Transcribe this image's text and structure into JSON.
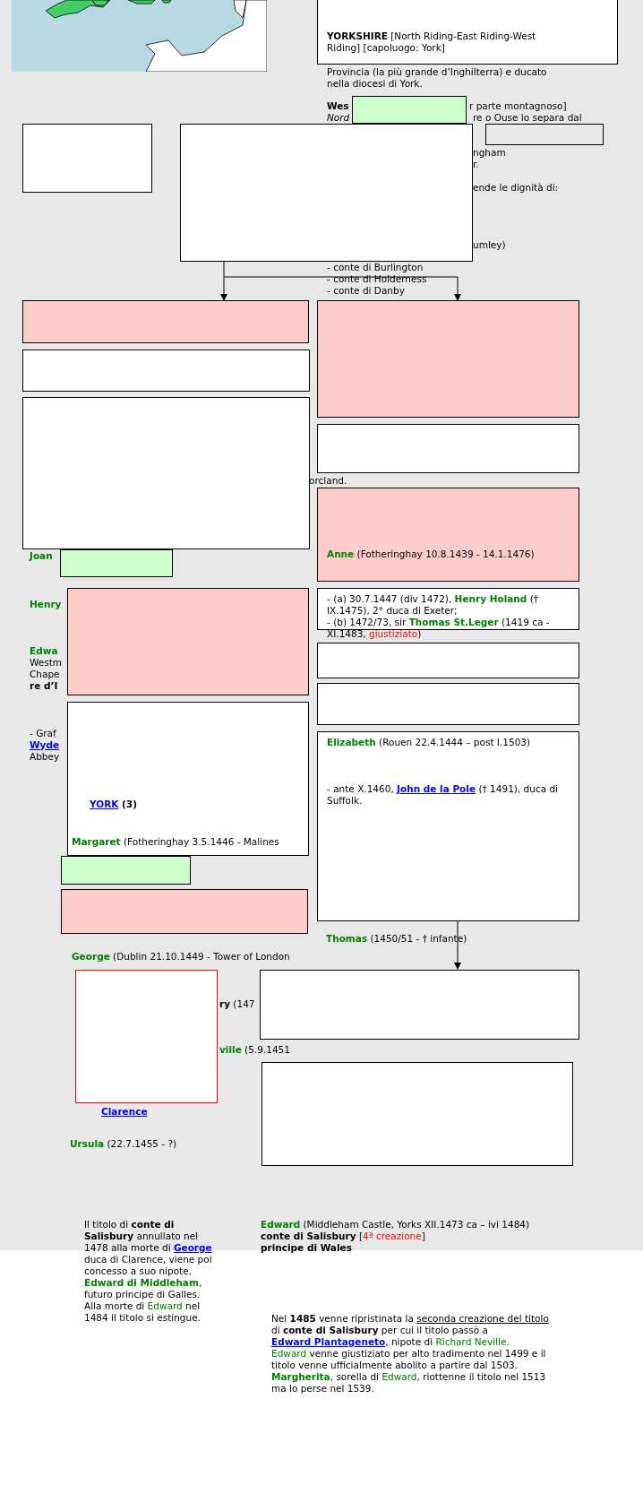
{
  "boxes": [
    {
      "kind": "filled",
      "color": "#ffffff"
    },
    {
      "kind": "filled",
      "color": "#ccffcc"
    },
    {
      "kind": "filled",
      "color": "#ffffff"
    },
    {
      "kind": "filled",
      "color": "#ffffff"
    },
    {
      "kind": "outline"
    },
    {
      "kind": "filled",
      "color": "#ffcccc"
    },
    {
      "kind": "filled",
      "color": "#ffcccc"
    },
    {
      "kind": "filled",
      "color": "#ffffff"
    },
    {
      "kind": "filled",
      "color": "#ffffff"
    },
    {
      "kind": "filled",
      "color": "#ffffff"
    },
    {
      "kind": "filled",
      "color": "#ffcccc"
    },
    {
      "kind": "filled",
      "color": "#ccffcc"
    },
    {
      "kind": "filled",
      "color": "#ffcccc"
    },
    {
      "kind": "filled",
      "color": "#ffffff"
    },
    {
      "kind": "filled",
      "color": "#ffffff"
    },
    {
      "kind": "filled",
      "color": "#ffffff"
    },
    {
      "kind": "filled",
      "color": "#ffffff"
    },
    {
      "kind": "filled",
      "color": "#ffffff"
    },
    {
      "kind": "filled",
      "color": "#ccffcc"
    },
    {
      "kind": "filled",
      "color": "#ffcccc"
    },
    {
      "kind": "alert"
    },
    {
      "kind": "filled",
      "color": "#ffffff"
    },
    {
      "kind": "filled",
      "color": "#ffffff"
    }
  ],
  "texts": [
    {
      "parts": [
        {
          "text": "YORKSHIRE",
          "kind": "bold"
        },
        {
          "text": " [North Riding-East Riding-West Riding] [capoluogo: York]",
          "kind": "plain"
        }
      ]
    },
    {
      "parts": [
        {
          "text": "Provincia (la più grande d’Inghilterra) e ducato nella diocesi di York.",
          "kind": "plain"
        }
      ]
    },
    {
      "parts": [
        {
          "text": "Wes",
          "kind": "bold"
        }
      ]
    },
    {
      "parts": [
        {
          "text": "r parte montagnoso]",
          "kind": "plain"
        }
      ]
    },
    {
      "parts": [
        {
          "text": "Nord",
          "kind": "italic"
        }
      ]
    },
    {
      "parts": [
        {
          "text": "re o Ouse lo separa dal",
          "kind": "plain"
        }
      ]
    },
    {
      "parts": [
        {
          "text": "ngham",
          "kind": "plain"
        }
      ]
    },
    {
      "parts": [
        {
          "text": "r.",
          "kind": "plain"
        }
      ]
    },
    {
      "parts": [
        {
          "text": "ende le dignità di:",
          "kind": "plain"
        }
      ]
    },
    {
      "parts": [
        {
          "text": "umley)",
          "kind": "plain"
        }
      ]
    },
    {
      "parts": [
        {
          "text": "- conte di Burlington",
          "kind": "plain"
        }
      ]
    },
    {
      "parts": [
        {
          "text": "- conte di Holderness",
          "kind": "plain"
        }
      ]
    },
    {
      "parts": [
        {
          "text": "- conte di Danby",
          "kind": "plain"
        }
      ]
    },
    {
      "parts": [
        {
          "text": "orcland.",
          "kind": "plain"
        }
      ]
    },
    {
      "parts": [
        {
          "text": "Joan",
          "kind": "name"
        }
      ]
    },
    {
      "parts": [
        {
          "text": "Anne",
          "kind": "name"
        },
        {
          "text": " (Fotheringhay 10.8.1439 - 14.1.1476)",
          "kind": "plain"
        }
      ]
    },
    {
      "parts": [
        {
          "text": "Henry",
          "kind": "name"
        }
      ]
    },
    {
      "parts": [
        {
          "text": "- (a) 30.7.1447 (div 1472), ",
          "kind": "plain"
        },
        {
          "text": "Henry Holand",
          "kind": "name"
        },
        {
          "text": " († IX.1475), 2° duca di Exeter;\n- (b) 1472/73, sir ",
          "kind": "plain"
        },
        {
          "text": "Thomas St.Leger",
          "kind": "name"
        },
        {
          "text": " (1419 ca - XI.1483, ",
          "kind": "plain"
        },
        {
          "text": "giustiziato",
          "kind": "red"
        },
        {
          "text": ")",
          "kind": "plain"
        }
      ]
    },
    {
      "parts": [
        {
          "text": "Edwa",
          "kind": "name"
        }
      ]
    },
    {
      "parts": [
        {
          "text": "Westm",
          "kind": "plain"
        }
      ]
    },
    {
      "parts": [
        {
          "text": "Chape",
          "kind": "plain"
        }
      ]
    },
    {
      "parts": [
        {
          "text": "re d’I",
          "kind": "bold"
        }
      ]
    },
    {
      "parts": [
        {
          "text": "- Graf",
          "kind": "plain"
        }
      ]
    },
    {
      "parts": [
        {
          "text": "Wyde",
          "kind": "link"
        }
      ]
    },
    {
      "parts": [
        {
          "text": "Abbey",
          "kind": "plain"
        }
      ]
    },
    {
      "parts": [
        {
          "text": "Elizabeth",
          "kind": "name"
        },
        {
          "text": " (Rouen 22.4.1444 – post I.1503)",
          "kind": "plain"
        }
      ]
    },
    {
      "parts": [
        {
          "text": "- ante X.1460, ",
          "kind": "plain"
        },
        {
          "text": "John de la Pole",
          "kind": "link"
        },
        {
          "text": " († 1491), duca di Suffolk.",
          "kind": "plain"
        }
      ]
    },
    {
      "parts": [
        {
          "text": "YORK",
          "kind": "link"
        },
        {
          "text": " (3)",
          "kind": "bold"
        }
      ]
    },
    {
      "parts": [
        {
          "text": "Margaret",
          "kind": "name"
        },
        {
          "text": " (Fotheringhay 3.5.1446 - Malines",
          "kind": "plain"
        }
      ]
    },
    {
      "parts": [
        {
          "text": "Thomas",
          "kind": "name"
        },
        {
          "text": " (1450/51 - † infante)",
          "kind": "plain"
        }
      ]
    },
    {
      "parts": [
        {
          "text": "George",
          "kind": "name"
        },
        {
          "text": " (Dublin 21.10.1449 - Tower of London",
          "kind": "plain"
        }
      ]
    },
    {
      "parts": [
        {
          "text": "ry",
          "kind": "bold"
        },
        {
          "text": " (147",
          "kind": "plain"
        }
      ]
    },
    {
      "parts": [
        {
          "text": "ville",
          "kind": "name"
        },
        {
          "text": " (5.9.1451",
          "kind": "plain"
        }
      ]
    },
    {
      "parts": [
        {
          "text": "Clarence",
          "kind": "link"
        }
      ]
    },
    {
      "parts": [
        {
          "text": "Ursula",
          "kind": "name"
        },
        {
          "text": " (22.7.1455 - ?)",
          "kind": "plain"
        }
      ]
    },
    {
      "parts": [
        {
          "text": "Il titolo di ",
          "kind": "plain"
        },
        {
          "text": "conte di Salisbury",
          "kind": "bold"
        },
        {
          "text": " annullato nel 1478 alla morte di ",
          "kind": "plain"
        },
        {
          "text": "George",
          "kind": "link"
        },
        {
          "text": " duca di Clarence, viene poi concesso a suo nipote, ",
          "kind": "plain"
        },
        {
          "text": "Edward di Middleham",
          "kind": "name"
        },
        {
          "text": ", futuro principe di Galles. Alla morte di ",
          "kind": "plain"
        },
        {
          "text": "Edward",
          "kind": "green"
        },
        {
          "text": " nel 1484 il titolo si estingue.",
          "kind": "plain"
        }
      ]
    },
    {
      "parts": [
        {
          "text": "Edward",
          "kind": "name"
        },
        {
          "text": " (Middleham Castle, Yorks XII.1473 ca – ivi 1484)\n",
          "kind": "plain"
        },
        {
          "text": "conte di Salisbury",
          "kind": "bold"
        },
        {
          "text": " [",
          "kind": "plain"
        },
        {
          "text": "4ª creazione",
          "kind": "red"
        },
        {
          "text": "]\n",
          "kind": "plain"
        },
        {
          "text": "principe di Wales",
          "kind": "bold"
        }
      ]
    },
    {
      "parts": [
        {
          "text": "Nel ",
          "kind": "plain"
        },
        {
          "text": "1485",
          "kind": "bold"
        },
        {
          "text": " venne ripristinata la ",
          "kind": "plain"
        },
        {
          "text": "seconda creazione del titolo",
          "kind": "underline"
        },
        {
          "text": " di ",
          "kind": "plain"
        },
        {
          "text": "conte di Salisbury",
          "kind": "bold"
        },
        {
          "text": " per cui il titolo passò a ",
          "kind": "plain"
        },
        {
          "text": "Edward Plantageneto",
          "kind": "link"
        },
        {
          "text": ", nipote di ",
          "kind": "plain"
        },
        {
          "text": "Richard Neville",
          "kind": "green"
        },
        {
          "text": ".\n",
          "kind": "plain"
        },
        {
          "text": "Edward",
          "kind": "green"
        },
        {
          "text": " venne giustiziato per alto tradimento nel 1499 e il titolo venne ufficialmente abolito a partire dal 1503.\n",
          "kind": "plain"
        },
        {
          "text": "Margherita",
          "kind": "name"
        },
        {
          "text": ", sorella di ",
          "kind": "plain"
        },
        {
          "text": "Edward",
          "kind": "green"
        },
        {
          "text": ", riottenne il titolo nel 1513 ma lo perse nel 1539.",
          "kind": "plain"
        }
      ]
    }
  ]
}
